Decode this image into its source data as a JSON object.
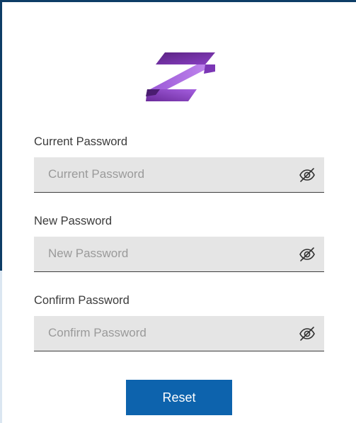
{
  "logo": {
    "icon": "z-ribbon-logo",
    "colors": [
      "#5b2a86",
      "#8e44c9",
      "#b06be0"
    ]
  },
  "fields": [
    {
      "label": "Current Password",
      "placeholder": "Current Password",
      "value": "",
      "toggle_icon": "eye-slash-icon"
    },
    {
      "label": "New Password",
      "placeholder": "New Password",
      "value": "",
      "toggle_icon": "eye-slash-icon"
    },
    {
      "label": "Confirm Password",
      "placeholder": "Confirm Password",
      "value": "",
      "toggle_icon": "eye-slash-icon"
    }
  ],
  "reset_button": {
    "label": "Reset",
    "color": "#0d63ad"
  },
  "colors": {
    "frame": "#0d3d66",
    "card": "#ffffff",
    "field_bg": "#e5e5e5"
  }
}
